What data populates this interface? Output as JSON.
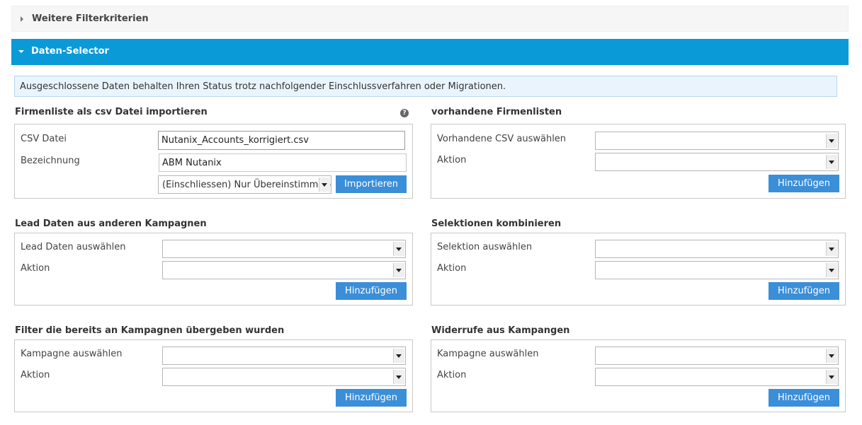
{
  "accordion": {
    "more_filters": "Weitere Filterkriterien",
    "data_selector": "Daten-Selector"
  },
  "info_text": "Ausgeschlossene Daten behalten Ihren Status trotz nachfolgender Einschlussverfahren oder Migrationen.",
  "csv_import": {
    "title": "Firmenliste als csv Datei importieren",
    "help_symbol": "?",
    "csv_label": "CSV Datei",
    "csv_value": "Nutanix_Accounts_korrigiert.csv",
    "name_label": "Bezeichnung",
    "name_value": "ABM Nutanix",
    "mode_value": "(Einschliessen) Nur Übereinstimmung",
    "import_button": "Importieren"
  },
  "existing_lists": {
    "title": "vorhandene Firmenlisten",
    "select_label": "Vorhandene CSV auswählen",
    "action_label": "Aktion",
    "add_button": "Hinzufügen"
  },
  "lead_data": {
    "title": "Lead Daten aus anderen Kampagnen",
    "select_label": "Lead Daten auswählen",
    "action_label": "Aktion",
    "add_button": "Hinzufügen"
  },
  "combine": {
    "title": "Selektionen kombinieren",
    "select_label": "Selektion auswählen",
    "action_label": "Aktion",
    "add_button": "Hinzufügen"
  },
  "passed_filters": {
    "title": "Filter die bereits an Kampagnen übergeben wurden",
    "select_label": "Kampagne auswählen",
    "action_label": "Aktion",
    "add_button": "Hinzufügen"
  },
  "revocations": {
    "title": "Widerrufe aus Kampangen",
    "select_label": "Kampagne auswählen",
    "action_label": "Aktion",
    "add_button": "Hinzufügen"
  }
}
